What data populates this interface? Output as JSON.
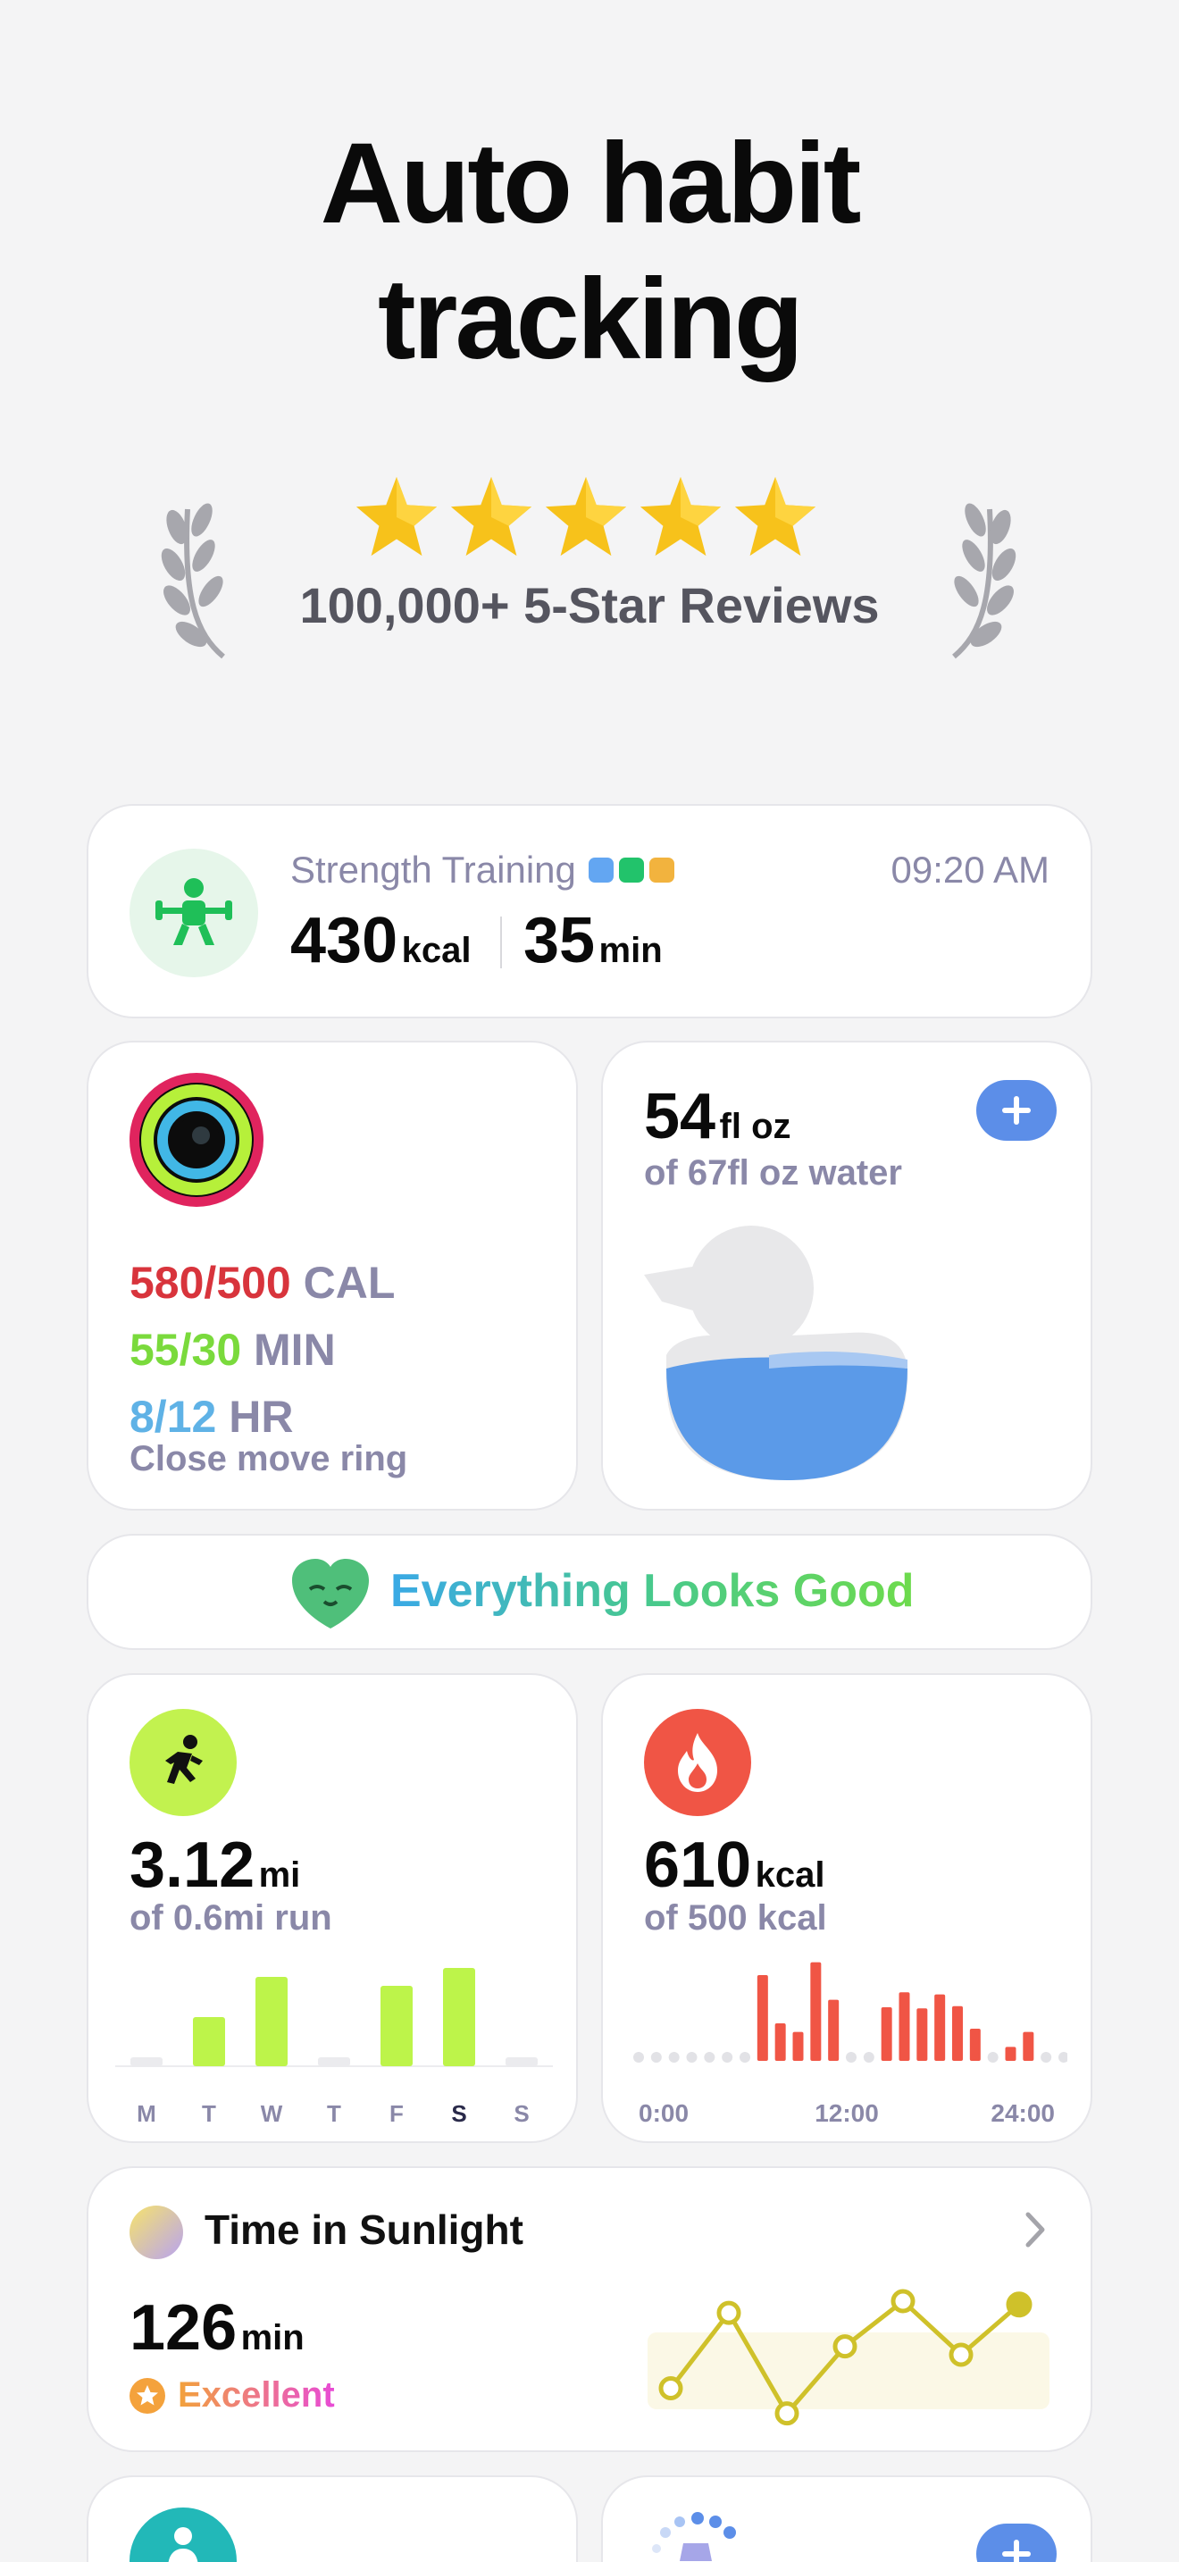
{
  "headline": {
    "line1": "Auto habit",
    "line2": "tracking"
  },
  "reviews": {
    "text": "100,000+ 5-Star Reviews",
    "stars": 5,
    "star_color": "#f7c21b"
  },
  "workout": {
    "title": "Strength Training",
    "time": "09:20 AM",
    "kcal_value": "430",
    "kcal_unit": "kcal",
    "min_value": "35",
    "min_unit": "min",
    "dot_colors": [
      "#63a6f2",
      "#22c36b",
      "#f2b33e"
    ]
  },
  "activity": {
    "move_value": "580/500",
    "move_label": "CAL",
    "exercise_value": "55/30",
    "exercise_label": "MIN",
    "stand_value": "8/12",
    "stand_label": "HR",
    "note": "Close move ring",
    "colors": {
      "move": "#d8343c",
      "exercise": "#7ada3c",
      "stand": "#5fb2e6"
    }
  },
  "water": {
    "value": "54",
    "unit": "fl oz",
    "subtitle": "of 67fl oz water",
    "fill_fraction": 0.8
  },
  "status": {
    "text": "Everything Looks Good"
  },
  "run": {
    "value": "3.12",
    "unit": "mi",
    "subtitle": "of 0.6mi run",
    "days": [
      "M",
      "T",
      "W",
      "T",
      "F",
      "S",
      "S"
    ],
    "values": [
      0,
      0.55,
      1.0,
      0,
      0.9,
      1.1,
      0
    ],
    "highlight_index": 5,
    "color": "#bdf44a"
  },
  "burn": {
    "value": "610",
    "unit": "kcal",
    "subtitle": "of 500 kcal",
    "x_labels": [
      "0:00",
      "12:00",
      "24:00"
    ],
    "values": [
      0,
      0,
      0,
      0,
      0,
      0,
      0,
      8,
      3.5,
      2.7,
      9.2,
      5.7,
      0,
      0,
      5,
      6.4,
      4.9,
      6.2,
      5.1,
      3,
      0,
      1.3,
      2.7,
      0,
      0
    ],
    "color": "#f05545"
  },
  "sunlight": {
    "title": "Time in Sunlight",
    "value": "126",
    "unit": "min",
    "rating": "Excellent",
    "trend": [
      2,
      6.5,
      0.5,
      4.5,
      7.2,
      4,
      7
    ]
  }
}
